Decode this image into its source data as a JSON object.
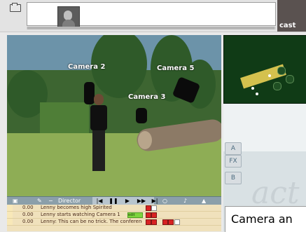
{
  "top": {
    "brand": "cast"
  },
  "viewport": {
    "camera_labels": [
      "Camera 2",
      "Camera 5",
      "Camera 3"
    ]
  },
  "toolbar": {
    "director": "Director"
  },
  "timeline": {
    "rows": [
      {
        "time": "0.00",
        "text": "Lenny becomes high Spirited"
      },
      {
        "time": "0.00",
        "text": "Lenny starts watching Camera 1"
      },
      {
        "time": "0.00",
        "text": "Lenny: This can be no trick. The conference was sa..."
      }
    ],
    "status": "edit"
  },
  "side_buttons": [
    "FX",
    "A",
    "B"
  ],
  "caption": {
    "text": "Camera an"
  },
  "right": {
    "brand_text": "act"
  }
}
